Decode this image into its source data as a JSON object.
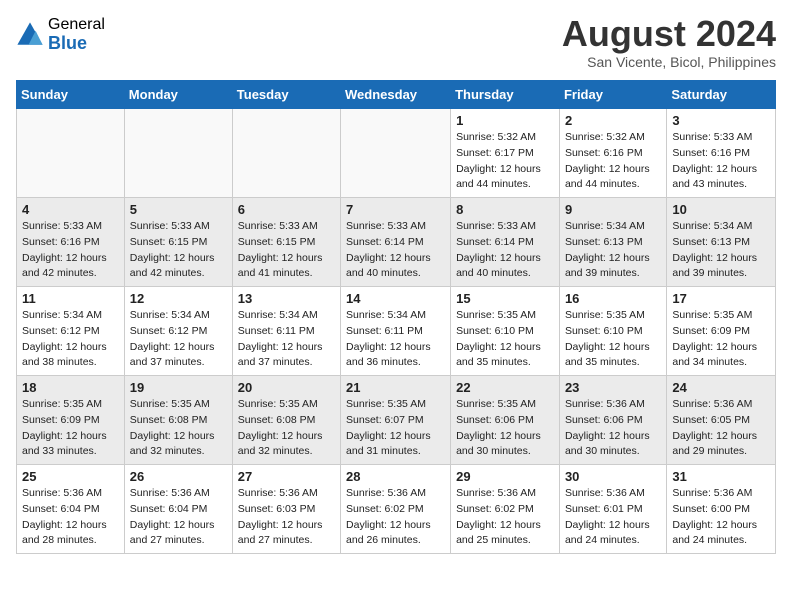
{
  "header": {
    "logo_general": "General",
    "logo_blue": "Blue",
    "month_year": "August 2024",
    "location": "San Vicente, Bicol, Philippines"
  },
  "weekdays": [
    "Sunday",
    "Monday",
    "Tuesday",
    "Wednesday",
    "Thursday",
    "Friday",
    "Saturday"
  ],
  "weeks": [
    [
      {
        "day": "",
        "info": ""
      },
      {
        "day": "",
        "info": ""
      },
      {
        "day": "",
        "info": ""
      },
      {
        "day": "",
        "info": ""
      },
      {
        "day": "1",
        "info": "Sunrise: 5:32 AM\nSunset: 6:17 PM\nDaylight: 12 hours\nand 44 minutes."
      },
      {
        "day": "2",
        "info": "Sunrise: 5:32 AM\nSunset: 6:16 PM\nDaylight: 12 hours\nand 44 minutes."
      },
      {
        "day": "3",
        "info": "Sunrise: 5:33 AM\nSunset: 6:16 PM\nDaylight: 12 hours\nand 43 minutes."
      }
    ],
    [
      {
        "day": "4",
        "info": "Sunrise: 5:33 AM\nSunset: 6:16 PM\nDaylight: 12 hours\nand 42 minutes."
      },
      {
        "day": "5",
        "info": "Sunrise: 5:33 AM\nSunset: 6:15 PM\nDaylight: 12 hours\nand 42 minutes."
      },
      {
        "day": "6",
        "info": "Sunrise: 5:33 AM\nSunset: 6:15 PM\nDaylight: 12 hours\nand 41 minutes."
      },
      {
        "day": "7",
        "info": "Sunrise: 5:33 AM\nSunset: 6:14 PM\nDaylight: 12 hours\nand 40 minutes."
      },
      {
        "day": "8",
        "info": "Sunrise: 5:33 AM\nSunset: 6:14 PM\nDaylight: 12 hours\nand 40 minutes."
      },
      {
        "day": "9",
        "info": "Sunrise: 5:34 AM\nSunset: 6:13 PM\nDaylight: 12 hours\nand 39 minutes."
      },
      {
        "day": "10",
        "info": "Sunrise: 5:34 AM\nSunset: 6:13 PM\nDaylight: 12 hours\nand 39 minutes."
      }
    ],
    [
      {
        "day": "11",
        "info": "Sunrise: 5:34 AM\nSunset: 6:12 PM\nDaylight: 12 hours\nand 38 minutes."
      },
      {
        "day": "12",
        "info": "Sunrise: 5:34 AM\nSunset: 6:12 PM\nDaylight: 12 hours\nand 37 minutes."
      },
      {
        "day": "13",
        "info": "Sunrise: 5:34 AM\nSunset: 6:11 PM\nDaylight: 12 hours\nand 37 minutes."
      },
      {
        "day": "14",
        "info": "Sunrise: 5:34 AM\nSunset: 6:11 PM\nDaylight: 12 hours\nand 36 minutes."
      },
      {
        "day": "15",
        "info": "Sunrise: 5:35 AM\nSunset: 6:10 PM\nDaylight: 12 hours\nand 35 minutes."
      },
      {
        "day": "16",
        "info": "Sunrise: 5:35 AM\nSunset: 6:10 PM\nDaylight: 12 hours\nand 35 minutes."
      },
      {
        "day": "17",
        "info": "Sunrise: 5:35 AM\nSunset: 6:09 PM\nDaylight: 12 hours\nand 34 minutes."
      }
    ],
    [
      {
        "day": "18",
        "info": "Sunrise: 5:35 AM\nSunset: 6:09 PM\nDaylight: 12 hours\nand 33 minutes."
      },
      {
        "day": "19",
        "info": "Sunrise: 5:35 AM\nSunset: 6:08 PM\nDaylight: 12 hours\nand 32 minutes."
      },
      {
        "day": "20",
        "info": "Sunrise: 5:35 AM\nSunset: 6:08 PM\nDaylight: 12 hours\nand 32 minutes."
      },
      {
        "day": "21",
        "info": "Sunrise: 5:35 AM\nSunset: 6:07 PM\nDaylight: 12 hours\nand 31 minutes."
      },
      {
        "day": "22",
        "info": "Sunrise: 5:35 AM\nSunset: 6:06 PM\nDaylight: 12 hours\nand 30 minutes."
      },
      {
        "day": "23",
        "info": "Sunrise: 5:36 AM\nSunset: 6:06 PM\nDaylight: 12 hours\nand 30 minutes."
      },
      {
        "day": "24",
        "info": "Sunrise: 5:36 AM\nSunset: 6:05 PM\nDaylight: 12 hours\nand 29 minutes."
      }
    ],
    [
      {
        "day": "25",
        "info": "Sunrise: 5:36 AM\nSunset: 6:04 PM\nDaylight: 12 hours\nand 28 minutes."
      },
      {
        "day": "26",
        "info": "Sunrise: 5:36 AM\nSunset: 6:04 PM\nDaylight: 12 hours\nand 27 minutes."
      },
      {
        "day": "27",
        "info": "Sunrise: 5:36 AM\nSunset: 6:03 PM\nDaylight: 12 hours\nand 27 minutes."
      },
      {
        "day": "28",
        "info": "Sunrise: 5:36 AM\nSunset: 6:02 PM\nDaylight: 12 hours\nand 26 minutes."
      },
      {
        "day": "29",
        "info": "Sunrise: 5:36 AM\nSunset: 6:02 PM\nDaylight: 12 hours\nand 25 minutes."
      },
      {
        "day": "30",
        "info": "Sunrise: 5:36 AM\nSunset: 6:01 PM\nDaylight: 12 hours\nand 24 minutes."
      },
      {
        "day": "31",
        "info": "Sunrise: 5:36 AM\nSunset: 6:00 PM\nDaylight: 12 hours\nand 24 minutes."
      }
    ]
  ]
}
